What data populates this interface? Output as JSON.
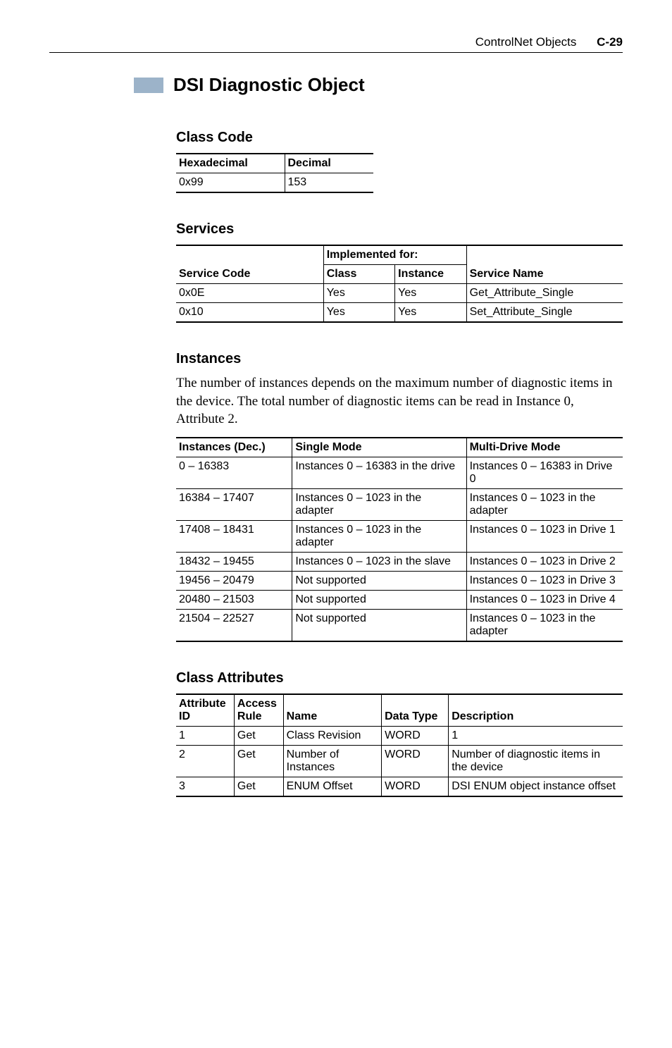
{
  "header": {
    "section": "ControlNet Objects",
    "page": "C-29"
  },
  "title": "DSI Diagnostic Object",
  "class_code": {
    "heading": "Class Code",
    "cols": [
      "Hexadecimal",
      "Decimal"
    ],
    "row": [
      "0x99",
      "153"
    ]
  },
  "services": {
    "heading": "Services",
    "group_header": "Implemented for:",
    "cols": [
      "Service Code",
      "Class",
      "Instance",
      "Service Name"
    ],
    "rows": [
      [
        "0x0E",
        "Yes",
        "Yes",
        "Get_Attribute_Single"
      ],
      [
        "0x10",
        "Yes",
        "Yes",
        "Set_Attribute_Single"
      ]
    ]
  },
  "instances": {
    "heading": "Instances",
    "paragraph": "The number of instances depends on the maximum number of diagnostic items in the device. The total number of diagnostic items can be read in Instance 0, Attribute 2.",
    "cols": [
      "Instances (Dec.)",
      "Single Mode",
      "Multi-Drive Mode"
    ],
    "rows": [
      [
        "0 – 16383",
        "Instances 0 – 16383 in the drive",
        "Instances 0 – 16383 in Drive 0"
      ],
      [
        "16384 – 17407",
        "Instances 0 – 1023 in the adapter",
        "Instances 0 – 1023 in the adapter"
      ],
      [
        "17408 – 18431",
        "Instances 0 – 1023 in the adapter",
        "Instances 0 – 1023 in Drive 1"
      ],
      [
        "18432 – 19455",
        "Instances 0 – 1023 in the slave",
        "Instances 0 – 1023 in Drive 2"
      ],
      [
        "19456 – 20479",
        "Not supported",
        "Instances 0 – 1023 in Drive 3"
      ],
      [
        "20480 – 21503",
        "Not supported",
        "Instances 0 – 1023 in Drive 4"
      ],
      [
        "21504 – 22527",
        "Not supported",
        "Instances 0 – 1023 in the adapter"
      ]
    ]
  },
  "class_attrs": {
    "heading": "Class Attributes",
    "cols": {
      "c1a": "Attribute",
      "c1b": "ID",
      "c2a": "Access",
      "c2b": "Rule",
      "c3": "Name",
      "c4": "Data Type",
      "c5": "Description"
    },
    "rows": [
      [
        "1",
        "Get",
        "Class Revision",
        "WORD",
        "1"
      ],
      [
        "2",
        "Get",
        "Number of Instances",
        "WORD",
        "Number of diagnostic items in the device"
      ],
      [
        "3",
        "Get",
        "ENUM Offset",
        "WORD",
        "DSI ENUM object instance offset"
      ]
    ]
  }
}
